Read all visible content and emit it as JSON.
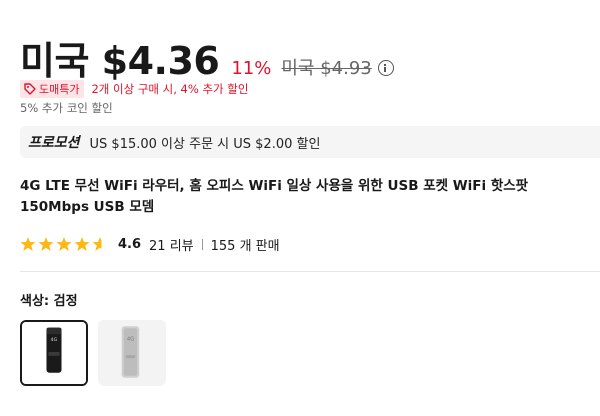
{
  "price": {
    "current": "미국 $4.36",
    "discount": "11%",
    "original": "미국 $4.93"
  },
  "deal": {
    "badge": "도매특가",
    "text": "2개 이상 구매 시, 4% 추가 할인"
  },
  "coin_text": "5% 추가 코인 할인",
  "promo": {
    "label": "프로모션",
    "text": "US $15.00 이상 주문 시 US $2.00 할인"
  },
  "product": {
    "title": "4G LTE 무선 WiFi 라우터, 홈 오피스 WiFi 일상 사용을 위한 USB 포켓 WiFi 핫스팟 150Mbps USB 모뎀"
  },
  "rating": {
    "value": "4.6",
    "stars": 4.6,
    "reviews": "21 리뷰",
    "sold": "155 개 판매"
  },
  "color": {
    "label": "색상: 검정",
    "options": [
      {
        "name": "black",
        "selected": true
      },
      {
        "name": "white",
        "selected": false
      }
    ]
  },
  "colors": {
    "accent_red": "#e0132a",
    "star": "#fdb813",
    "text": "#191919"
  }
}
